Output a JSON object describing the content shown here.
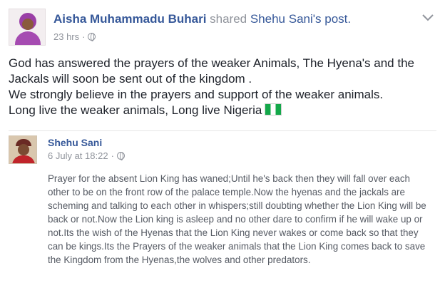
{
  "post": {
    "author": "Aisha Muhammadu Buhari",
    "action": " shared ",
    "shared_owner": "Shehu Sani's post.",
    "time": "23 hrs",
    "separator": "·",
    "lines": [
      "God has answered the prayers of the weaker Animals, The Hyena's and the Jackals will soon be sent out of the kingdom .",
      "We strongly believe in the prayers and support of the weaker animals.",
      "Long live the weaker animals, Long live Nigeria"
    ],
    "flag_icon": "nigeria-flag-icon"
  },
  "shared_post": {
    "author": "Shehu Sani",
    "date": "6 July at 18:22",
    "separator": "·",
    "text": "Prayer for the absent Lion King has waned;Until he's back then they will fall over each other to be on the front row of the palace temple.Now the hyenas and the jackals are scheming and talking to each other in whispers;still doubting whether the Lion King will be back or not.Now the Lion king is asleep and no other dare to confirm if he will wake up or not.Its the wish of the Hyenas that the Lion King never wakes or come back so that they can be kings.Its the Prayers of the weaker animals that the Lion King comes back to save the Kingdom from the Hyenas,the wolves and other predators."
  },
  "colors": {
    "link": "#365899",
    "meta": "#90949c",
    "text": "#1d2129",
    "shared_text": "#555a63"
  }
}
